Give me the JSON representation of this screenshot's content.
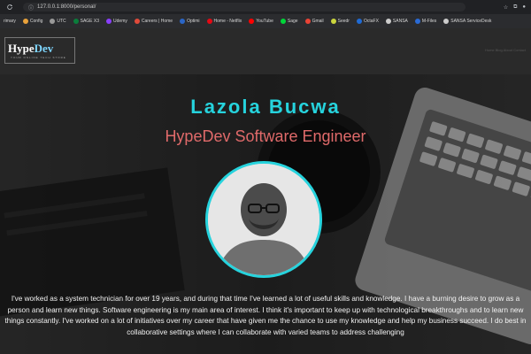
{
  "browser": {
    "url": "127.0.0.1:8000/personal/",
    "bookmarks": [
      "rimary",
      "Config",
      "UTC",
      "SAGE X3",
      "Udemy",
      "Careers | Home",
      "Optimi",
      "Home - Netflix",
      "YouTube",
      "Sage",
      "Gmail",
      "Seedr",
      "OctaFX",
      "SANSA",
      "M-Files",
      "SANSA ServiceDesk"
    ]
  },
  "header": {
    "logo_main": "Hype",
    "logo_accent": "Dev",
    "tagline": "YOUR ONLINE TECH STORE",
    "links": "Home  Blog  About  Contact"
  },
  "hero": {
    "name": "Lazola Bucwa",
    "role": "HypeDev Software Engineer",
    "bio": "I've worked as a system technician for over 19 years, and during that time I've learned a lot of useful skills and knowledge. I have a burning desire to grow as a person and learn new things. Software engineering is my main area of interest. I think it's important to keep up with technological breakthroughs and to learn new things constantly. I've worked on a lot of initiatives over my career that have given me the chance to use my knowledge and help my business succeed. I do best in collaborative settings where I can collaborate with varied teams to address challenging"
  },
  "colors": {
    "accent": "#26d3dd",
    "role": "#e06a6a",
    "header_bg": "#2a2a2a"
  }
}
